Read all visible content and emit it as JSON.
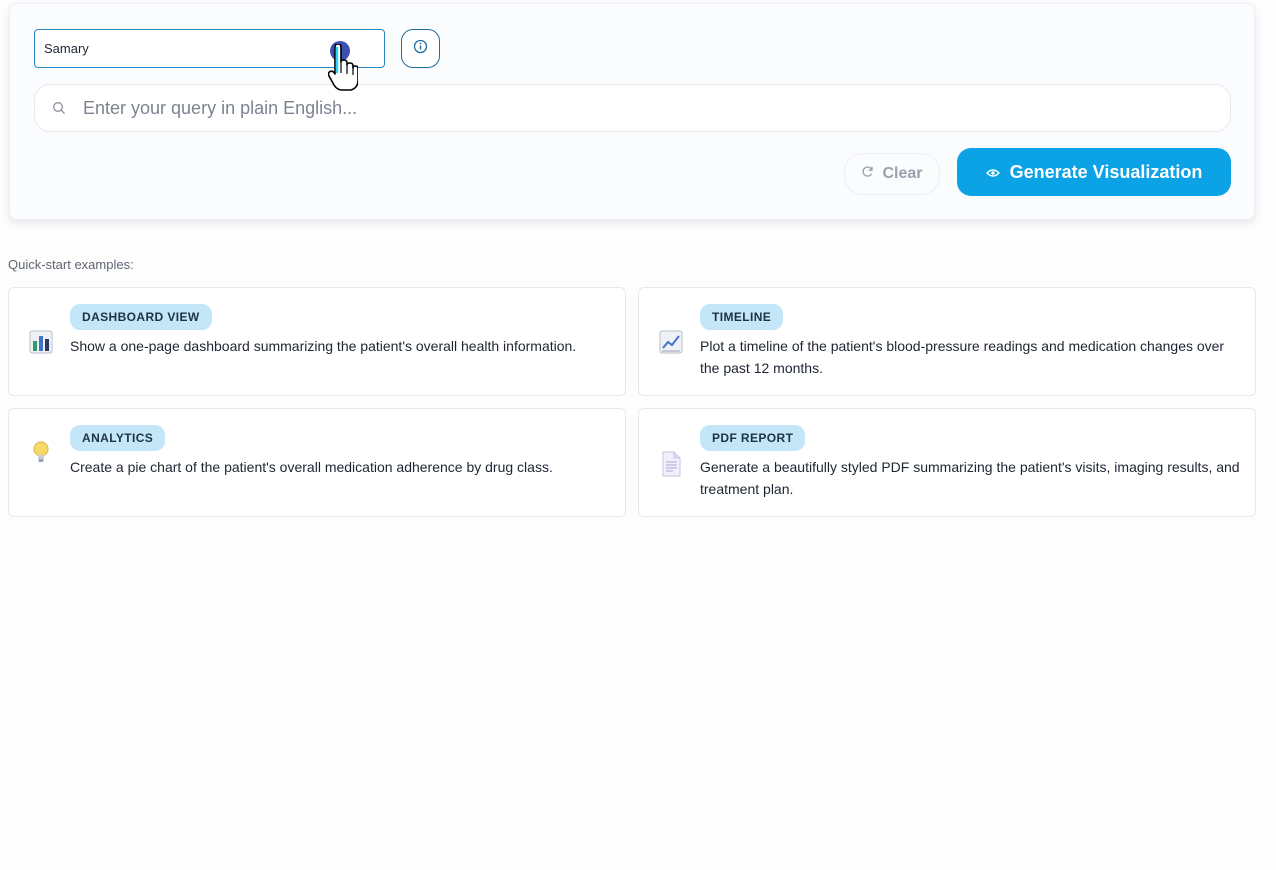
{
  "query": {
    "select": {
      "value": "Samary",
      "chevron_icon": "chevron-down-icon"
    },
    "info_icon": "info-circle-icon",
    "search": {
      "icon": "search-icon",
      "placeholder": "Enter your query in plain English...",
      "value": ""
    },
    "clear_button": {
      "icon": "refresh-icon",
      "label": "Clear"
    },
    "generate_button": {
      "icon": "eye-icon",
      "label": "Generate Visualization"
    }
  },
  "quick_start": {
    "label": "Quick-start examples:",
    "cards": [
      {
        "icon": "bar-chart-icon",
        "tag": "DASHBOARD VIEW",
        "text": "Show a one-page dashboard summarizing the patient's overall health information."
      },
      {
        "icon": "line-chart-icon",
        "tag": "TIMELINE",
        "text": "Plot a timeline of the patient's blood-pressure readings and medication changes over the past 12 months."
      },
      {
        "icon": "lightbulb-icon",
        "tag": "ANALYTICS",
        "text": "Create a pie chart of the patient's overall medication adherence by drug class."
      },
      {
        "icon": "document-icon",
        "tag": "PDF REPORT",
        "text": "Generate a beautifully styled PDF summarizing the patient's visits, imaging results, and treatment plan."
      }
    ]
  },
  "colors": {
    "accent": "#0ba2e6",
    "tag_background": "#c3e6f8",
    "select_border": "#2a8ac9"
  }
}
